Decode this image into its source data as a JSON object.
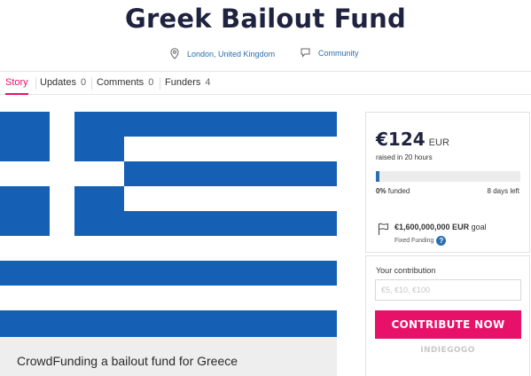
{
  "campaign": {
    "title": "Greek Bailout Fund",
    "location": "London, United Kingdom",
    "category": "Community"
  },
  "tabs": [
    {
      "label": "Story",
      "count": ""
    },
    {
      "label": "Updates",
      "count": "0"
    },
    {
      "label": "Comments",
      "count": "0"
    },
    {
      "label": "Funders",
      "count": "4"
    }
  ],
  "media": {
    "caption": "CrowdFunding a bailout fund for Greece",
    "flag_colors": {
      "blue": "#1560b5",
      "white": "#ffffff"
    }
  },
  "funding": {
    "amount": "€124",
    "currency": "EUR",
    "raised_text": "raised in 20 hours",
    "percent_label": "0%",
    "funded_label": "funded",
    "days_left": "8 days left",
    "progress_fraction": 0.0,
    "goal_amount": "€1,600,000,000 EUR",
    "goal_label": "goal",
    "funding_type": "Fixed Funding"
  },
  "contribution": {
    "label": "Your contribution",
    "placeholder": "€5, €10, €100",
    "button_label": "CONTRIBUTE NOW",
    "brand": "INDIEGOGO"
  },
  "colors": {
    "accent": "#e8116a",
    "link": "#2a6fb0",
    "title": "#1f2340"
  },
  "icons": [
    "location-pin-icon",
    "category-icon",
    "flag-icon",
    "help-icon"
  ]
}
